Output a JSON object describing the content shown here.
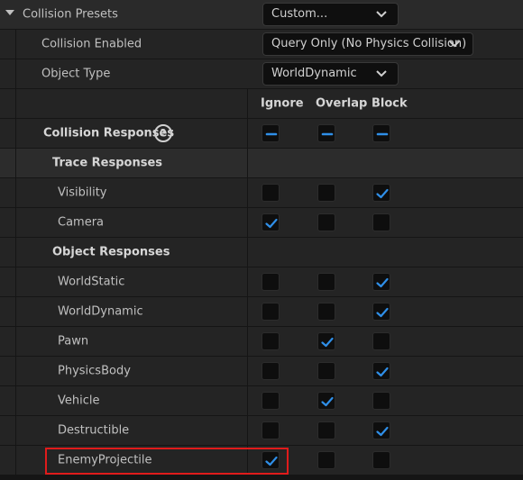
{
  "section": {
    "title": "Collision Presets",
    "preset_value": "Custom..."
  },
  "fields": {
    "collision_enabled_label": "Collision Enabled",
    "collision_enabled_value": "Query Only (No Physics Collision)",
    "object_type_label": "Object Type",
    "object_type_value": "WorldDynamic"
  },
  "columns": [
    "Ignore",
    "Overlap",
    "Block"
  ],
  "collision_responses": {
    "label": "Collision Responses",
    "help": "?",
    "states": [
      "mixed",
      "mixed",
      "mixed"
    ]
  },
  "trace_responses": {
    "label": "Trace Responses",
    "rows": [
      {
        "name": "Visibility",
        "checks": [
          false,
          false,
          true
        ]
      },
      {
        "name": "Camera",
        "checks": [
          true,
          false,
          false
        ]
      }
    ]
  },
  "object_responses": {
    "label": "Object Responses",
    "rows": [
      {
        "name": "WorldStatic",
        "checks": [
          false,
          false,
          true
        ]
      },
      {
        "name": "WorldDynamic",
        "checks": [
          false,
          false,
          true
        ]
      },
      {
        "name": "Pawn",
        "checks": [
          false,
          true,
          false
        ]
      },
      {
        "name": "PhysicsBody",
        "checks": [
          false,
          false,
          true
        ]
      },
      {
        "name": "Vehicle",
        "checks": [
          false,
          true,
          false
        ]
      },
      {
        "name": "Destructible",
        "checks": [
          false,
          false,
          true
        ]
      },
      {
        "name": "EnemyProjectile",
        "checks": [
          true,
          false,
          false
        ]
      }
    ]
  },
  "colors": {
    "accent": "#2f8fe8",
    "highlight": "#e01b1b"
  }
}
